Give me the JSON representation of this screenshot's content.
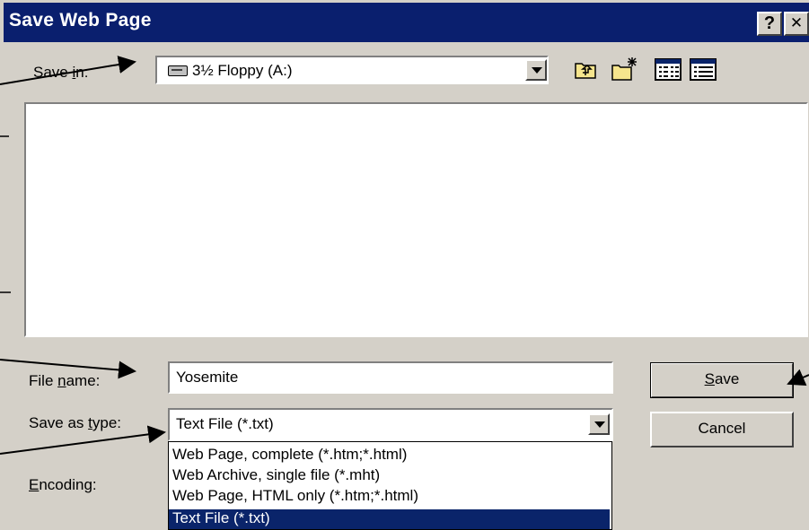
{
  "window": {
    "title": "Save Web Page",
    "help_glyph": "?",
    "close_glyph": "✕"
  },
  "save_in": {
    "label_pre": "Save ",
    "label_ul": "i",
    "label_post": "n:",
    "value": "3½ Floppy (A:)",
    "icon": "floppy-drive-icon"
  },
  "toolbar": {
    "up_folder_icon": "up-one-level-icon",
    "new_folder_icon": "create-new-folder-icon",
    "list_view_icon": "list-view-icon",
    "details_view_icon": "details-view-icon"
  },
  "file_name": {
    "label_pre": "File ",
    "label_ul": "n",
    "label_post": "ame:",
    "value": "Yosemite"
  },
  "save_as_type": {
    "label_pre": "Save as ",
    "label_ul": "t",
    "label_post": "ype:",
    "value": "Text File (*.txt)",
    "options": [
      "Web Page, complete (*.htm;*.html)",
      "Web Archive, single file (*.mht)",
      "Web Page, HTML only (*.htm;*.html)",
      "Text File (*.txt)"
    ],
    "selected_index": 3
  },
  "encoding": {
    "label_ul": "E",
    "label_post": "ncoding:"
  },
  "buttons": {
    "save_ul": "S",
    "save_post": "ave",
    "cancel": "Cancel"
  },
  "colors": {
    "titlebar": "#0a1f6e",
    "dialog_bg": "#d4d0c8",
    "selection": "#0a246a"
  }
}
